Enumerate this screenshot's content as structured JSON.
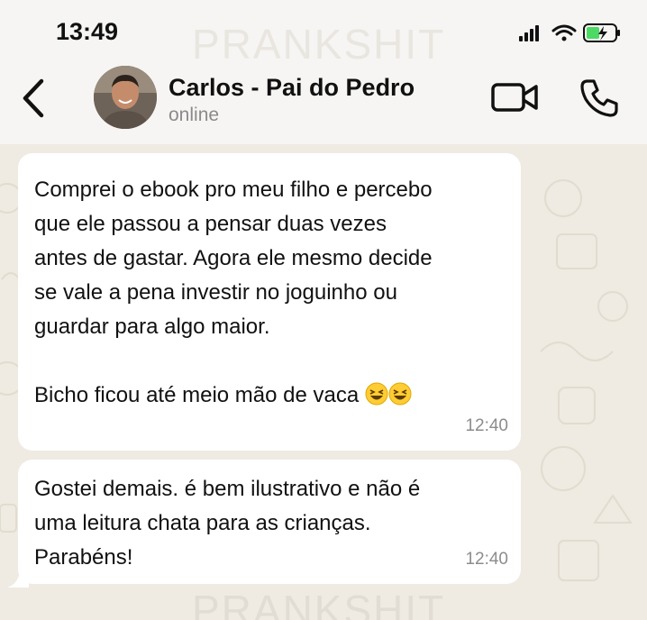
{
  "status_bar": {
    "time": "13:49"
  },
  "watermark": "PRANKSHIT",
  "header": {
    "contact_name": "Carlos - Pai do Pedro",
    "presence": "online",
    "icons": {
      "back": "chevron-left-icon",
      "video": "video-camera-icon",
      "call": "phone-icon"
    }
  },
  "messages": [
    {
      "text": "Comprei o ebook pro meu filho e percebo\nque ele passou a pensar duas vezes\nantes de gastar. Agora ele mesmo decide\nse vale a pena investir no joguinho ou\nguardar para algo maior.\n\nBicho ficou até meio mão de vaca ",
      "emoji": "😆😆",
      "time": "12:40"
    },
    {
      "text": "Gostei demais. é bem ilustrativo e não é\numa leitura chata para as crianças.\nParabéns!",
      "time": "12:40"
    }
  ],
  "colors": {
    "header_bg": "#f6f5f3",
    "chat_bg": "#efeae2",
    "bubble_bg": "#ffffff",
    "timestamp": "#8c8c8c",
    "battery_charge": "#4cd964"
  }
}
